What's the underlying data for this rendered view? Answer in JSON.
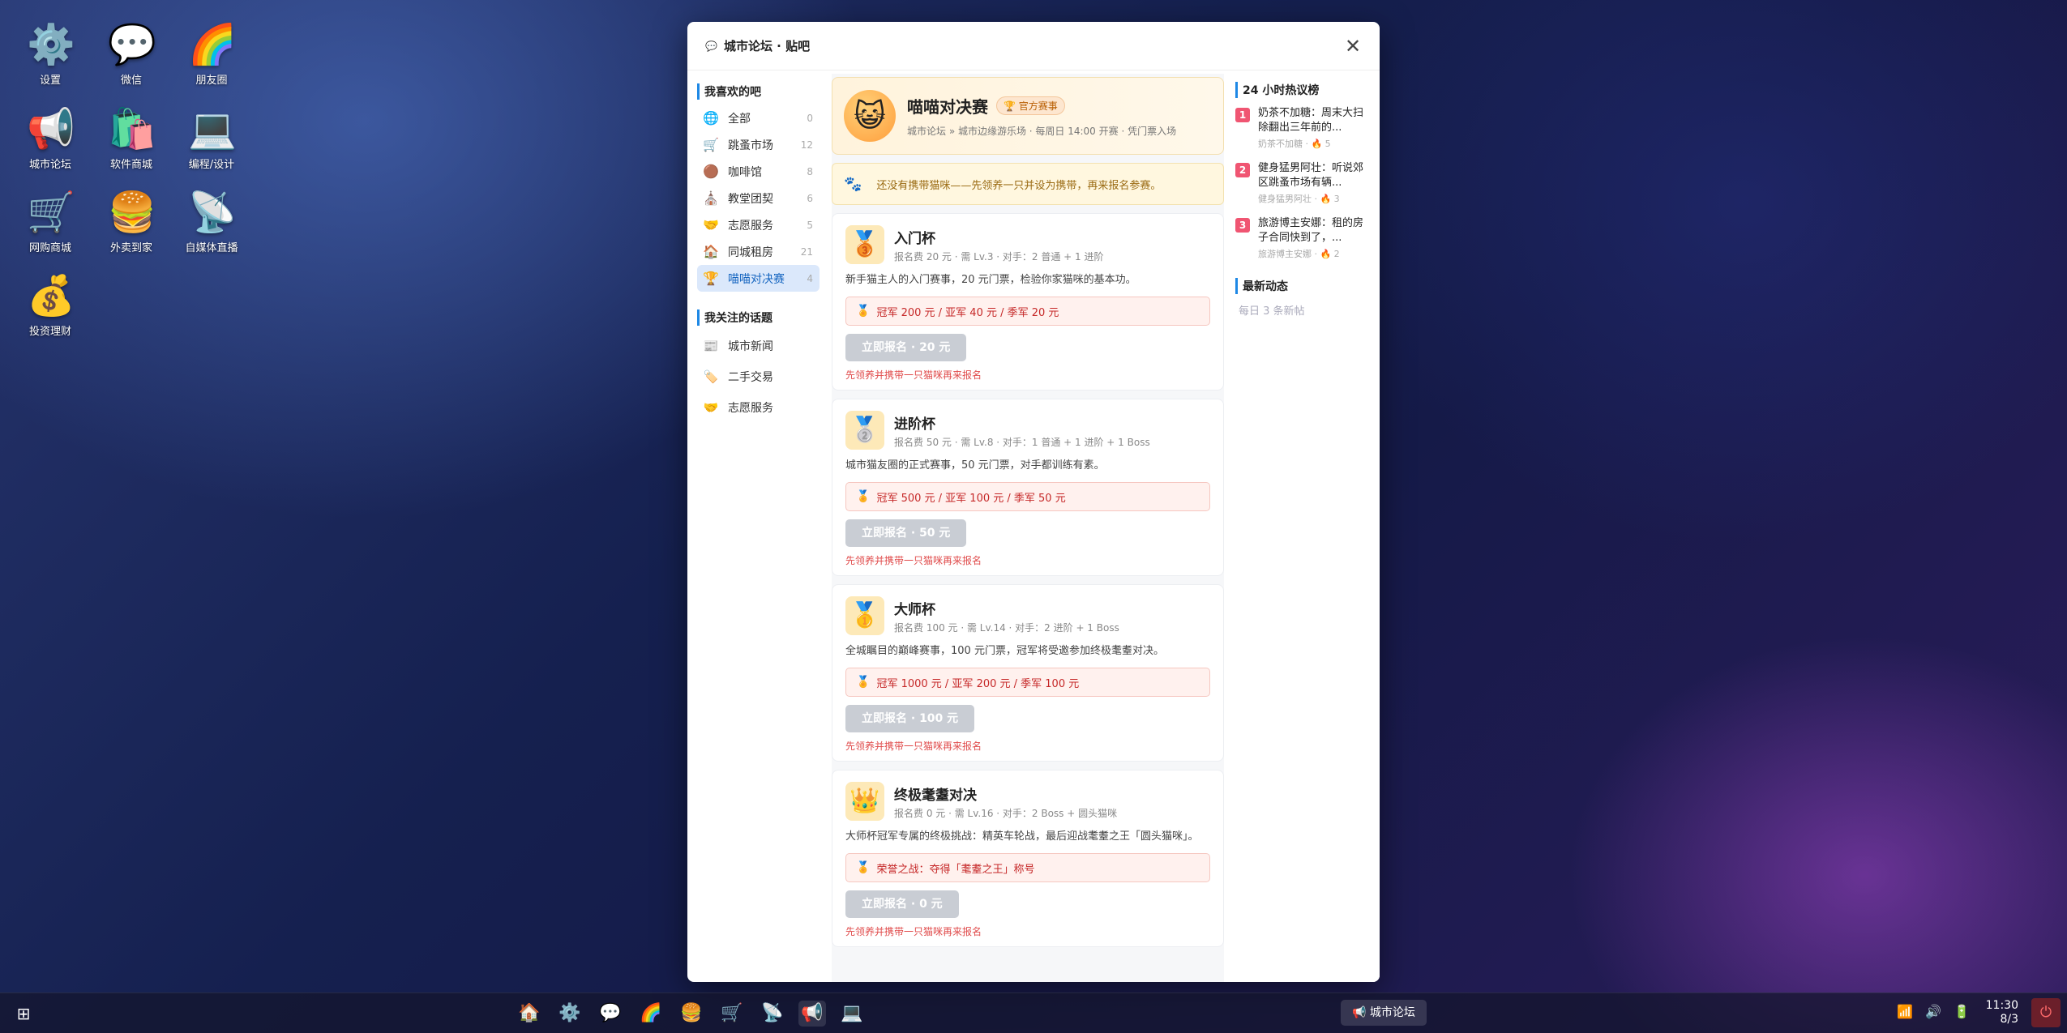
{
  "desktop": {
    "icons": [
      {
        "label": "设置",
        "icon": "⚙️"
      },
      {
        "label": "微信",
        "icon": "💬"
      },
      {
        "label": "朋友圈",
        "icon": "🌈"
      },
      {
        "label": "城市论坛",
        "icon": "📢"
      },
      {
        "label": "软件商城",
        "icon": "🛍️"
      },
      {
        "label": "编程/设计",
        "icon": "💻"
      },
      {
        "label": "网购商城",
        "icon": "🛒"
      },
      {
        "label": "外卖到家",
        "icon": "🍔"
      },
      {
        "label": "自媒体直播",
        "icon": "📡"
      },
      {
        "label": "投资理财",
        "icon": "💰"
      }
    ]
  },
  "window": {
    "title_icon": "💬",
    "title": "城市论坛 · 贴吧",
    "close": "✕"
  },
  "sidebar": {
    "fav_title": "我喜欢的吧",
    "items": [
      {
        "icon": "🌐",
        "label": "全部",
        "count": "0"
      },
      {
        "icon": "🛒",
        "label": "跳蚤市场",
        "count": "12"
      },
      {
        "icon": "🟤",
        "label": "咖啡馆",
        "count": "8"
      },
      {
        "icon": "⛪",
        "label": "教堂团契",
        "count": "6"
      },
      {
        "icon": "🤝",
        "label": "志愿服务",
        "count": "5"
      },
      {
        "icon": "🏠",
        "label": "同城租房",
        "count": "21"
      },
      {
        "icon": "🏆",
        "label": "喵喵对决赛",
        "count": "4"
      }
    ],
    "topics_title": "我关注的话题",
    "topics": [
      {
        "icon": "📰",
        "label": "城市新闻"
      },
      {
        "icon": "🏷️",
        "label": "二手交易"
      },
      {
        "icon": "🤝",
        "label": "志愿服务"
      }
    ]
  },
  "hero": {
    "avatar": "😺",
    "name": "喵喵对决赛",
    "badge": "🏆 官方赛事",
    "sub": "城市论坛 » 城市边缘游乐场 · 每周日 14:00 开赛 · 凭门票入场"
  },
  "notice": {
    "icon": "🐾",
    "text": "还没有携带猫咪——先领养一只并设为携带，再来报名参赛。"
  },
  "cards": [
    {
      "icon": "🥉",
      "name": "入门杯",
      "meta": "报名费 20 元 · 需 Lv.3 · 对手：2 普通 + 1 进阶",
      "desc": "新手猫主人的入门赛事，20 元门票，检验你家猫咪的基本功。",
      "prize": "冠军 200 元 / 亚军 40 元 / 季军 20 元",
      "button": "立即报名 · 20 元",
      "warn": "先领养并携带一只猫咪再来报名"
    },
    {
      "icon": "🥈",
      "name": "进阶杯",
      "meta": "报名费 50 元 · 需 Lv.8 · 对手：1 普通 + 1 进阶 + 1 Boss",
      "desc": "城市猫友圈的正式赛事，50 元门票，对手都训练有素。",
      "prize": "冠军 500 元 / 亚军 100 元 / 季军 50 元",
      "button": "立即报名 · 50 元",
      "warn": "先领养并携带一只猫咪再来报名"
    },
    {
      "icon": "🥇",
      "name": "大师杯",
      "meta": "报名费 100 元 · 需 Lv.14 · 对手：2 进阶 + 1 Boss",
      "desc": "全城瞩目的巅峰赛事，100 元门票，冠军将受邀参加终极耄耋对决。",
      "prize": "冠军 1000 元 / 亚军 200 元 / 季军 100 元",
      "button": "立即报名 · 100 元",
      "warn": "先领养并携带一只猫咪再来报名"
    },
    {
      "icon": "👑",
      "name": "终极耄耋对决",
      "meta": "报名费 0 元 · 需 Lv.16 · 对手：2 Boss + 圆头猫咪",
      "desc": "大师杯冠军专属的终极挑战：精英车轮战，最后迎战耄耋之王「圆头猫咪」。",
      "prize": "荣誉之战：夺得「耄耋之王」称号",
      "button": "立即报名 · 0 元",
      "warn": "先领养并携带一只猫咪再来报名"
    }
  ],
  "right": {
    "hot_title": "24 小时热议榜",
    "hot": [
      {
        "rank": "1",
        "title": "奶茶不加糖：周末大扫除翻出三年前的...",
        "meta": "奶茶不加糖 · 🔥 5"
      },
      {
        "rank": "2",
        "title": "健身猛男阿壮：听说郊区跳蚤市场有辆...",
        "meta": "健身猛男阿壮 · 🔥 3"
      },
      {
        "rank": "3",
        "title": "旅游博主安娜：租的房子合同快到了，...",
        "meta": "旅游博主安娜 · 🔥 2"
      }
    ],
    "latest_title": "最新动态",
    "latest_empty": "每日 3 条新帖"
  },
  "taskbar": {
    "start": "⊞",
    "apps": [
      "🏠",
      "⚙️",
      "💬",
      "🌈",
      "🍔",
      "🛒",
      "📡",
      "📢",
      "💻"
    ],
    "running_app": "📢 城市论坛",
    "tray": [
      "📶",
      "🔊",
      "🔋"
    ],
    "time": "11:30",
    "date": "8/3",
    "power": "⏻"
  }
}
